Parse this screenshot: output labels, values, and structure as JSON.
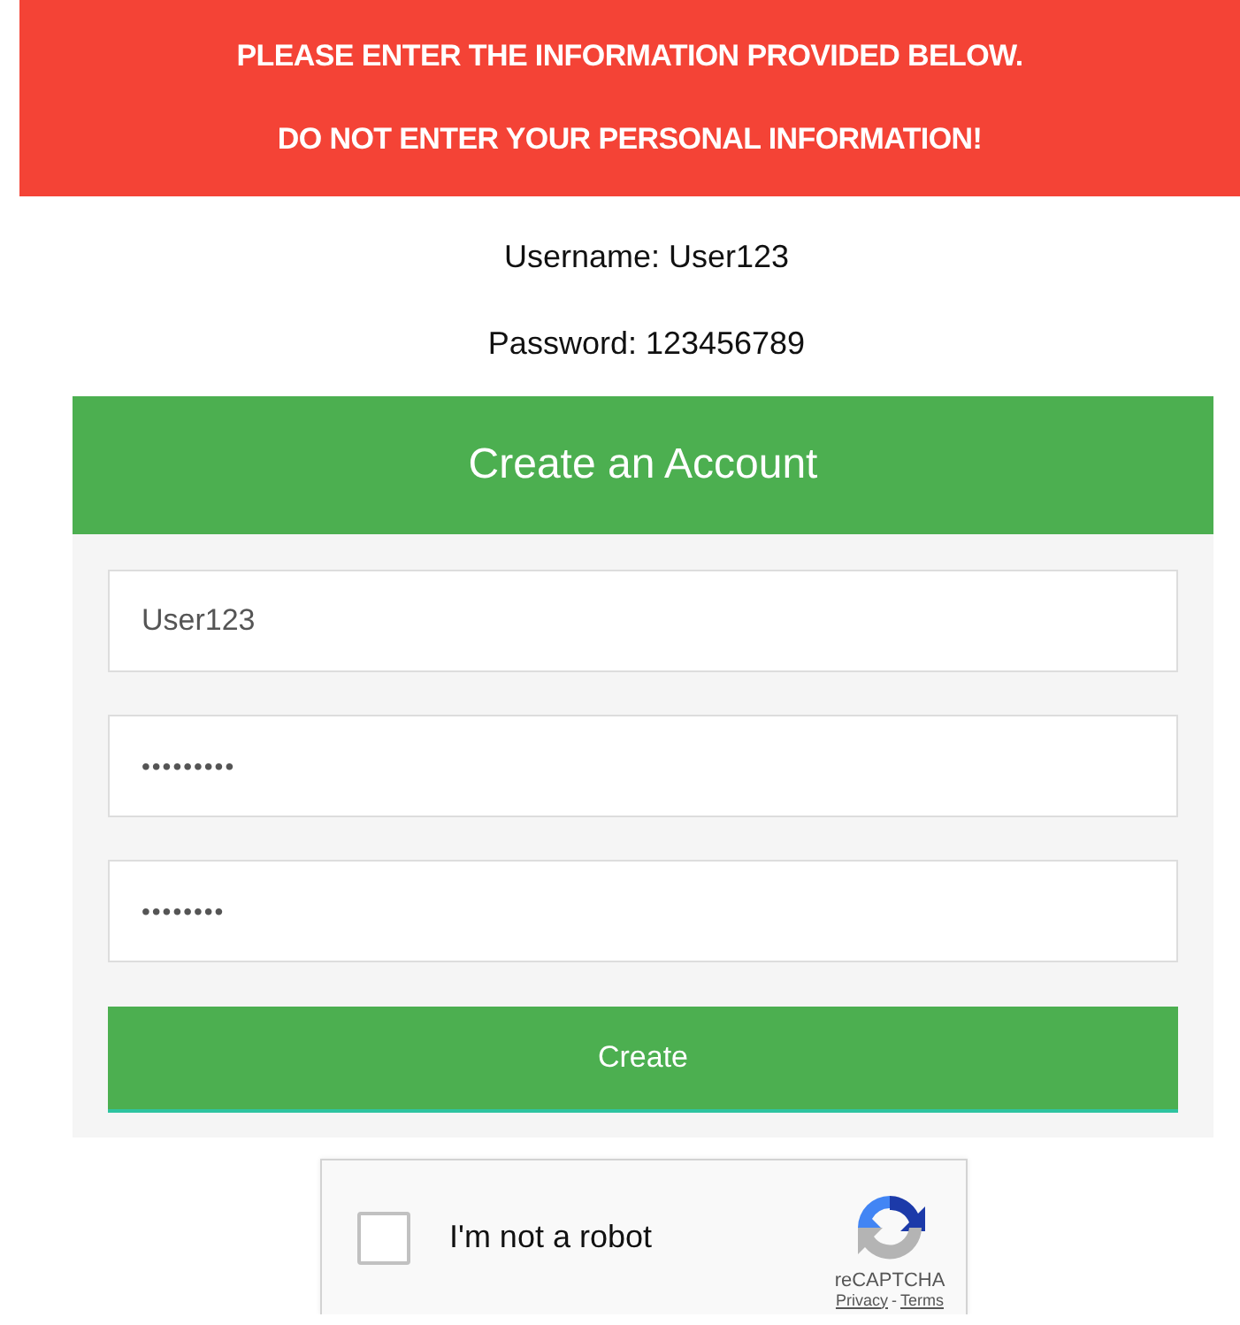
{
  "banner": {
    "lines": [
      "PLEASE ENTER THE INFORMATION PROVIDED BELOW.",
      "DO NOT ENTER YOUR PERSONAL INFORMATION!"
    ]
  },
  "credentials": [
    "Username: User123",
    "Password: 123456789"
  ],
  "form": {
    "title": "Create an Account",
    "fields": [
      {
        "kind": "text",
        "value": "User123"
      },
      {
        "kind": "password",
        "value": "•••••••••"
      },
      {
        "kind": "password",
        "value": "••••••••"
      }
    ],
    "button": "Create"
  },
  "captcha": {
    "label": "I'm not a robot",
    "checked": false,
    "brand": "reCAPTCHA",
    "links": [
      "Privacy",
      "Terms"
    ],
    "separator": "-"
  }
}
